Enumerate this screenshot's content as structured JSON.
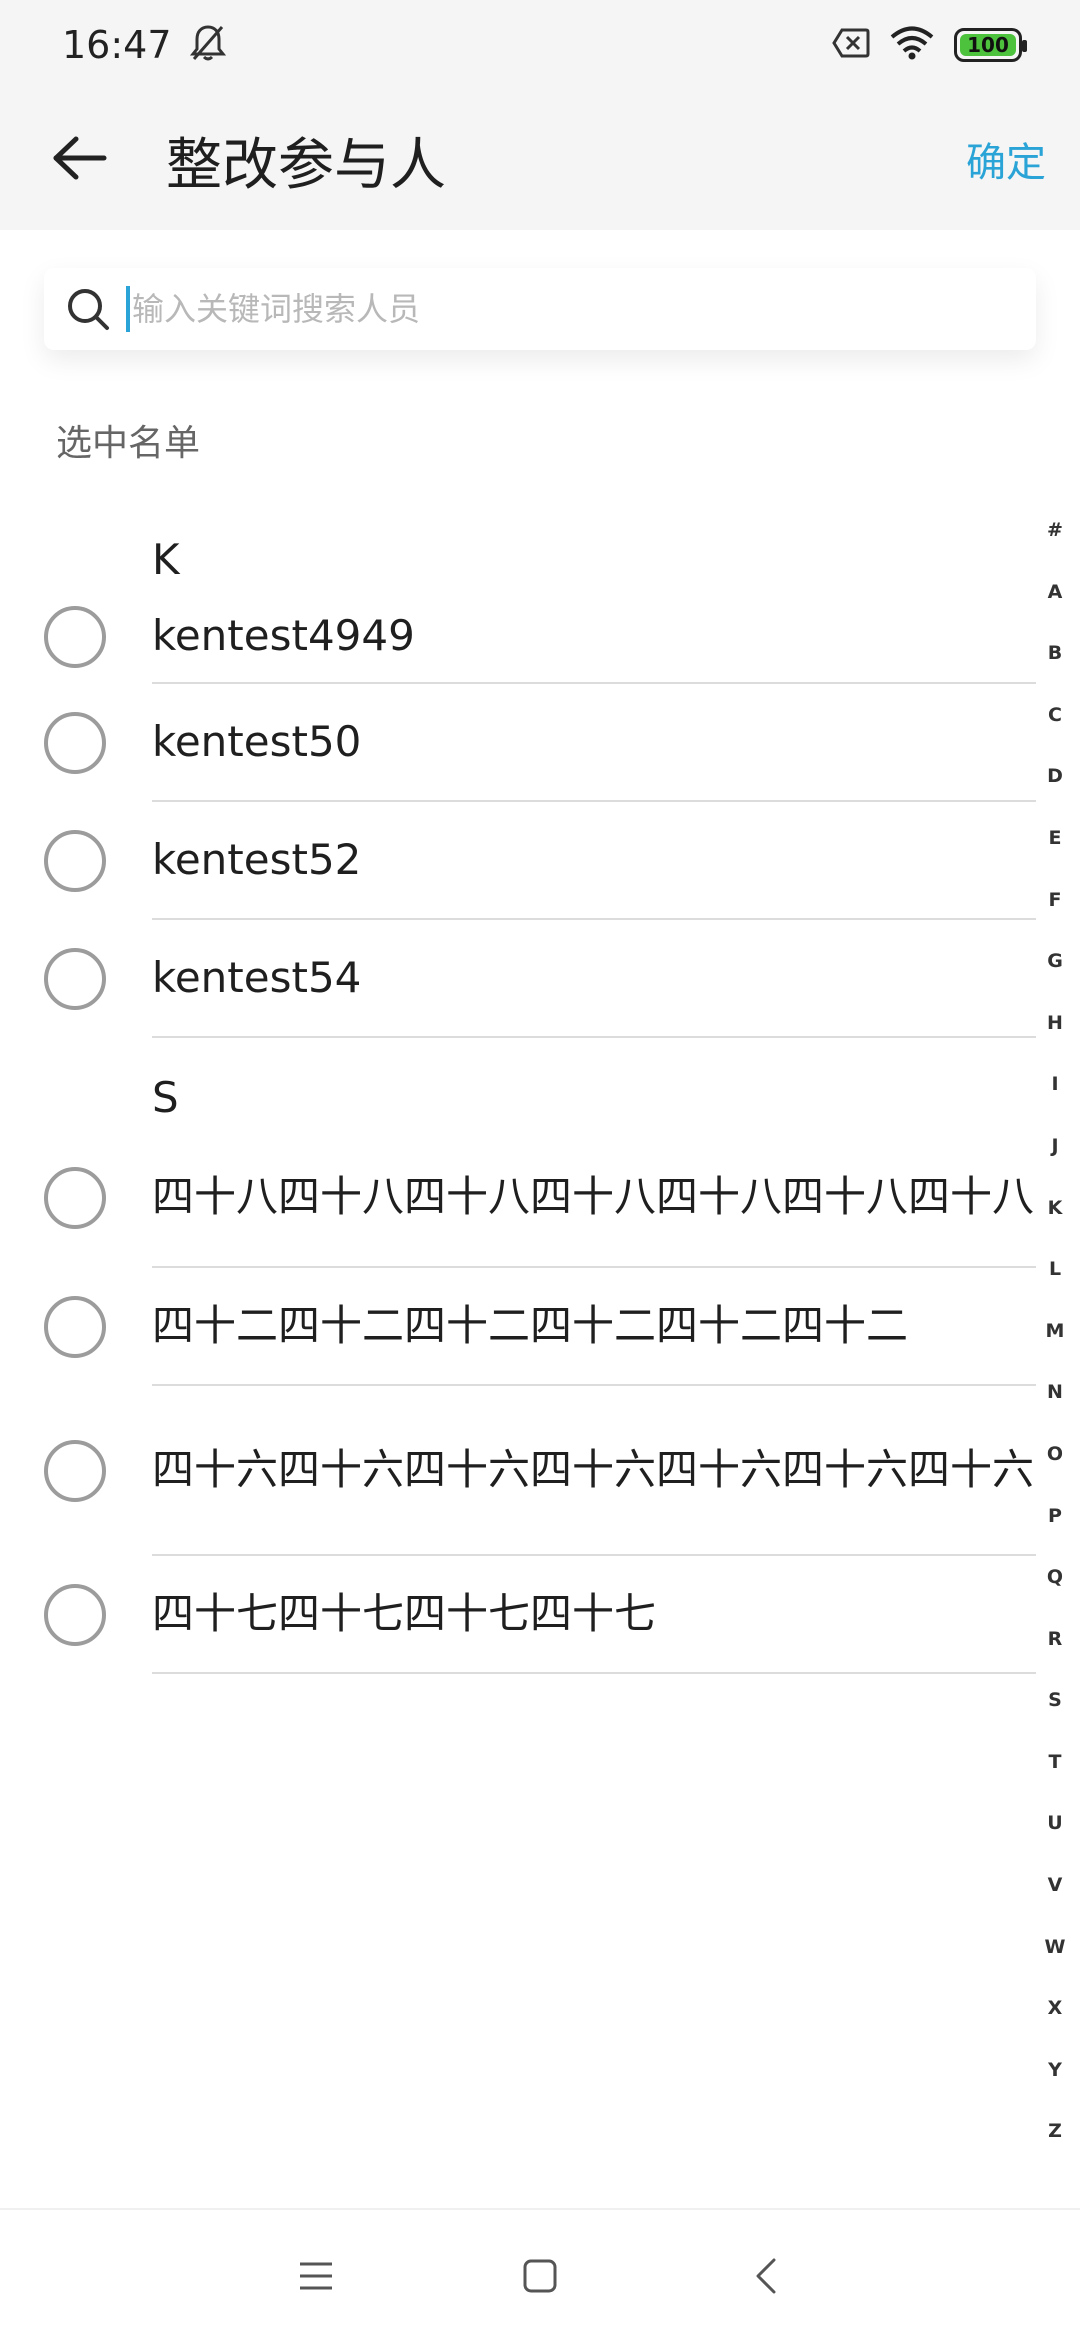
{
  "status_bar": {
    "time": "16:47",
    "battery": "100",
    "icons": [
      "bell-off-icon",
      "sim-x-icon",
      "wifi-icon",
      "battery-icon"
    ]
  },
  "header": {
    "title": "整改参与人",
    "confirm_label": "确定"
  },
  "search": {
    "placeholder": "输入关键词搜索人员",
    "value": ""
  },
  "selected_label": "选中名单",
  "sections": [
    {
      "letter": "K",
      "items": [
        {
          "name": "kentest4949",
          "checked": false
        },
        {
          "name": "kentest50",
          "checked": false
        },
        {
          "name": "kentest52",
          "checked": false
        },
        {
          "name": "kentest54",
          "checked": false
        }
      ]
    },
    {
      "letter": "S",
      "items": [
        {
          "name": "四十八四十八四十八四十八四十八四十八四十八",
          "checked": false
        },
        {
          "name": "四十二四十二四十二四十二四十二四十二",
          "checked": false
        },
        {
          "name": "四十六四十六四十六四十六四十六四十六四十六",
          "checked": false
        },
        {
          "name": "四十七四十七四十七四十七",
          "checked": false
        }
      ]
    }
  ],
  "index_letters": [
    "#",
    "A",
    "B",
    "C",
    "D",
    "E",
    "F",
    "G",
    "H",
    "I",
    "J",
    "K",
    "L",
    "M",
    "N",
    "O",
    "P",
    "Q",
    "R",
    "S",
    "T",
    "U",
    "V",
    "W",
    "X",
    "Y",
    "Z"
  ],
  "colors": {
    "accent": "#2aa3d6",
    "header_bg": "#f5f5f5",
    "battery": "#4cc23d"
  }
}
